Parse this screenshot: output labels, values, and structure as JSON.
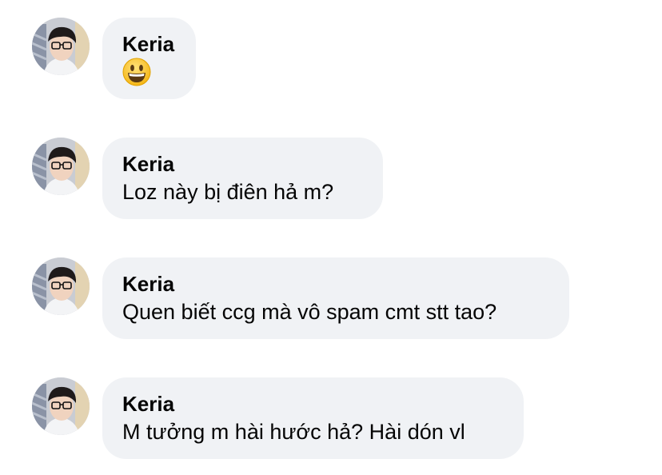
{
  "comments": [
    {
      "author": "Keria",
      "text": "",
      "emoji": "grinning-face-icon"
    },
    {
      "author": "Keria",
      "text": "Loz này bị điên hả m?"
    },
    {
      "author": "Keria",
      "text": "Quen biết ccg mà vô spam cmt stt tao?"
    },
    {
      "author": "Keria",
      "text": "M tưởng m hài hước hả? Hài dón vl"
    }
  ],
  "colors": {
    "bubble": "#f0f2f5",
    "text": "#050505",
    "emoji_face": "#fcc21b"
  }
}
